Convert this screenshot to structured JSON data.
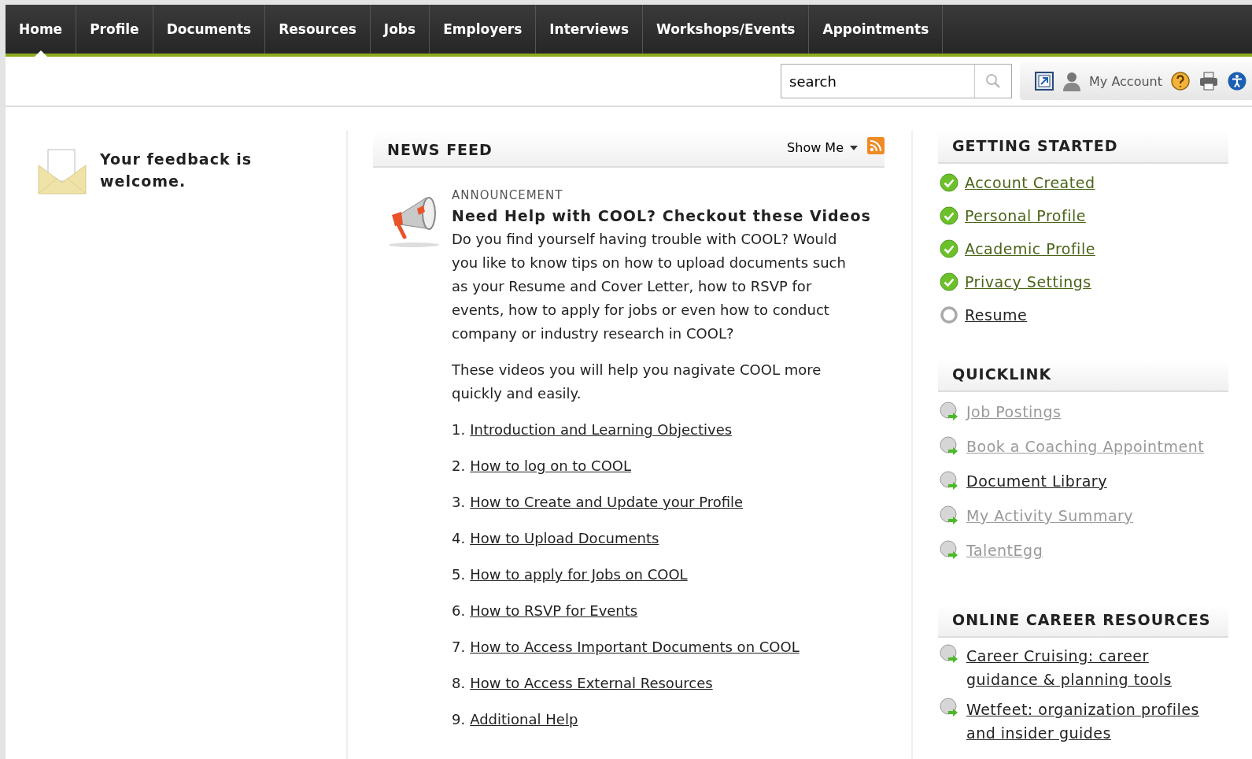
{
  "nav": {
    "tabs": [
      {
        "label": "Home",
        "selected": true
      },
      {
        "label": "Profile",
        "selected": false
      },
      {
        "label": "Documents",
        "selected": false
      },
      {
        "label": "Resources",
        "selected": false
      },
      {
        "label": "Jobs",
        "selected": false
      },
      {
        "label": "Employers",
        "selected": false
      },
      {
        "label": "Interviews",
        "selected": false
      },
      {
        "label": "Workshops/Events",
        "selected": false
      },
      {
        "label": "Appointments",
        "selected": false
      }
    ]
  },
  "toolbar": {
    "search": {
      "value": "search"
    },
    "account_label": "My Account"
  },
  "feedback": {
    "text": "Your feedback is welcome."
  },
  "news_feed": {
    "title": "NEWS FEED",
    "show_me": "Show Me",
    "announcement": {
      "category": "ANNOUNCEMENT",
      "title": "Need Help with COOL? Checkout these Videos",
      "paragraphs": [
        "Do you find yourself having trouble with COOL? Would you like to know tips on how to upload documents such as your Resume and Cover Letter, how to RSVP for events, how to apply for jobs or even how to conduct company or industry research in COOL?",
        "These videos you will help you nagivate COOL more quickly and easily."
      ],
      "videos": [
        {
          "number": "1.",
          "title": "Introduction and Learning Objectives"
        },
        {
          "number": "2.",
          "title": "How to log on to COOL"
        },
        {
          "number": "3.",
          "title": "How to Create and Update your Profile"
        },
        {
          "number": "4.",
          "title": "How to Upload Documents"
        },
        {
          "number": "5.",
          "title": "How to apply for Jobs on COOL"
        },
        {
          "number": "6.",
          "title": "How to RSVP for Events"
        },
        {
          "number": "7.",
          "title": "How to Access Important Documents on COOL"
        },
        {
          "number": "8.",
          "title": "How to Access External Resources"
        },
        {
          "number": "9.",
          "title": "Additional Help"
        }
      ]
    }
  },
  "getting_started": {
    "title": "GETTING STARTED",
    "items": [
      {
        "label": "Account Created",
        "checked": true
      },
      {
        "label": "Personal Profile",
        "checked": true
      },
      {
        "label": "Academic Profile",
        "checked": true
      },
      {
        "label": "Privacy Settings",
        "checked": true
      },
      {
        "label": "Resume",
        "checked": false
      }
    ]
  },
  "quicklink": {
    "title": "QUICKLINK",
    "items": [
      {
        "label": "Job Postings",
        "visited": true
      },
      {
        "label": "Book a Coaching Appointment",
        "visited": true
      },
      {
        "label": "Document Library",
        "visited": false
      },
      {
        "label": "My Activity Summary",
        "visited": true
      },
      {
        "label": "TalentEgg",
        "visited": true
      }
    ]
  },
  "online_career_resources": {
    "title": "ONLINE CAREER RESOURCES",
    "items": [
      {
        "label": "Career Cruising: career guidance & planning tools",
        "visited": false
      },
      {
        "label": "Wetfeet: organization profiles and insider guides",
        "visited": false
      }
    ]
  }
}
